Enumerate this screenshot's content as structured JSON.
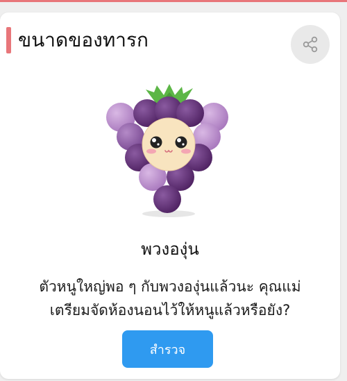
{
  "colors": {
    "accent_bar": "#e8767a",
    "button_blue": "#2f9af0",
    "grape_dark": "#5b2a6e",
    "grape_light": "#b98ac8",
    "leaf_green": "#5cb646",
    "face": "#f8e4bf"
  },
  "card": {
    "title": "ขนาดของทารก",
    "share_icon": "share-icon"
  },
  "fruit": {
    "icon": "grape-cluster-illustration",
    "name": "พวงองุ่น",
    "description_line1": "ตัวหนูใหญ่พอ ๆ กับพวงองุ่นแล้วนะ คุณแม่",
    "description_line2": "เตรียมจัดห้องนอนไว้ให้หนูแล้วหรือยัง?"
  },
  "actions": {
    "explore_label": "สำรวจ"
  }
}
